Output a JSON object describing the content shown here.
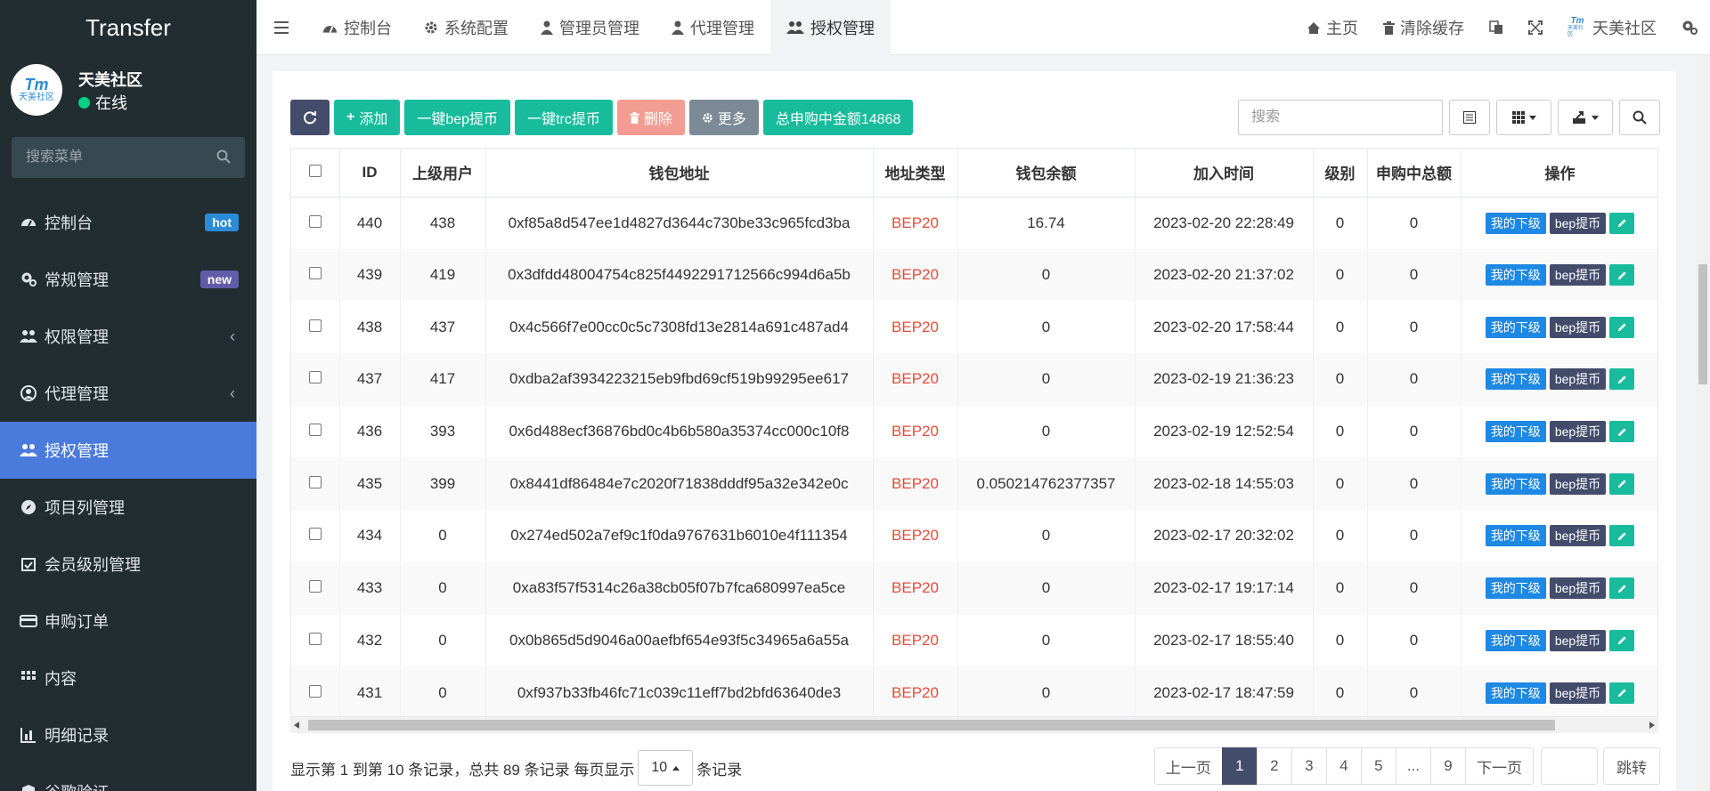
{
  "app": {
    "title": "Transfer",
    "user_name": "天美社区",
    "user_status": "在线",
    "logo_text": "Tm",
    "logo_sub": "天美社区"
  },
  "sidebar": {
    "search_placeholder": "搜索菜单",
    "items": [
      {
        "label": "控制台",
        "icon": "dashboard-icon",
        "badge": "hot"
      },
      {
        "label": "常规管理",
        "icon": "cogs-icon",
        "badge": "new"
      },
      {
        "label": "权限管理",
        "icon": "users-icon",
        "chevron": "‹"
      },
      {
        "label": "代理管理",
        "icon": "user-circle-icon",
        "chevron": "‹"
      },
      {
        "label": "授权管理",
        "icon": "users-icon",
        "active": true
      },
      {
        "label": "项目列管理",
        "icon": "compass-icon"
      },
      {
        "label": "会员级别管理",
        "icon": "calendar-check-icon"
      },
      {
        "label": "申购订单",
        "icon": "credit-card-icon"
      },
      {
        "label": "内容",
        "icon": "grid-icon"
      },
      {
        "label": "明细记录",
        "icon": "bar-chart-icon"
      },
      {
        "label": "谷歌验证",
        "icon": "shield-icon"
      }
    ]
  },
  "topnav": {
    "tabs": [
      {
        "label": "控制台",
        "icon": "dashboard-icon"
      },
      {
        "label": "系统配置",
        "icon": "gear-icon"
      },
      {
        "label": "管理员管理",
        "icon": "user-icon"
      },
      {
        "label": "代理管理",
        "icon": "user-icon"
      },
      {
        "label": "授权管理",
        "icon": "users-icon",
        "active": true
      }
    ],
    "right": {
      "home": "主页",
      "clear_cache": "清除缓存",
      "user": "天美社区"
    }
  },
  "toolbar": {
    "add": "添加",
    "bep_withdraw": "一键bep提币",
    "trc_withdraw": "一键trc提币",
    "delete": "删除",
    "more": "更多",
    "total": "总申购中金额14868",
    "search_placeholder": "搜索"
  },
  "table": {
    "headers": [
      "ID",
      "上级用户",
      "钱包地址",
      "地址类型",
      "钱包余额",
      "加入时间",
      "级别",
      "申购中总额",
      "操作"
    ],
    "op_labels": {
      "subordinates": "我的下级",
      "bep": "bep提币"
    },
    "rows": [
      {
        "id": "440",
        "parent": "438",
        "address": "0xf85a8d547ee1d4827d3644c730be33c965fcd3ba",
        "type": "BEP20",
        "balance": "16.74",
        "joined": "2023-02-20 22:28:49",
        "level": "0",
        "total": "0"
      },
      {
        "id": "439",
        "parent": "419",
        "address": "0x3dfdd48004754c825f4492291712566c994d6a5b",
        "type": "BEP20",
        "balance": "0",
        "joined": "2023-02-20 21:37:02",
        "level": "0",
        "total": "0"
      },
      {
        "id": "438",
        "parent": "437",
        "address": "0x4c566f7e00cc0c5c7308fd13e2814a691c487ad4",
        "type": "BEP20",
        "balance": "0",
        "joined": "2023-02-20 17:58:44",
        "level": "0",
        "total": "0"
      },
      {
        "id": "437",
        "parent": "417",
        "address": "0xdba2af3934223215eb9fbd69cf519b99295ee617",
        "type": "BEP20",
        "balance": "0",
        "joined": "2023-02-19 21:36:23",
        "level": "0",
        "total": "0"
      },
      {
        "id": "436",
        "parent": "393",
        "address": "0x6d488ecf36876bd0c4b6b580a35374cc000c10f8",
        "type": "BEP20",
        "balance": "0",
        "joined": "2023-02-19 12:52:54",
        "level": "0",
        "total": "0"
      },
      {
        "id": "435",
        "parent": "399",
        "address": "0x8441df86484e7c2020f71838dddf95a32e342e0c",
        "type": "BEP20",
        "balance": "0.050214762377357",
        "joined": "2023-02-18 14:55:03",
        "level": "0",
        "total": "0"
      },
      {
        "id": "434",
        "parent": "0",
        "address": "0x274ed502a7ef9c1f0da9767631b6010e4f111354",
        "type": "BEP20",
        "balance": "0",
        "joined": "2023-02-17 20:32:02",
        "level": "0",
        "total": "0"
      },
      {
        "id": "433",
        "parent": "0",
        "address": "0xa83f57f5314c26a38cb05f07b7fca680997ea5ce",
        "type": "BEP20",
        "balance": "0",
        "joined": "2023-02-17 19:17:14",
        "level": "0",
        "total": "0"
      },
      {
        "id": "432",
        "parent": "0",
        "address": "0x0b865d5d9046a00aefbf654e93f5c34965a6a55a",
        "type": "BEP20",
        "balance": "0",
        "joined": "2023-02-17 18:55:40",
        "level": "0",
        "total": "0"
      },
      {
        "id": "431",
        "parent": "0",
        "address": "0xf937b33fb46fc71c039c11eff7bd2bfd63640de3",
        "type": "BEP20",
        "balance": "0",
        "joined": "2023-02-17 18:47:59",
        "level": "0",
        "total": "0"
      }
    ]
  },
  "footer": {
    "info_prefix": "显示第 1 到第 10 条记录，总共 89 条记录 每页显示",
    "page_size": "10",
    "info_suffix": "条记录",
    "prev": "上一页",
    "next": "下一页",
    "pages": [
      "1",
      "2",
      "3",
      "4",
      "5",
      "...",
      "9"
    ],
    "active_page": "1",
    "jump": "跳转"
  },
  "colors": {
    "sidebar_bg": "#222d32",
    "active_menu": "#4a7bdc",
    "primary_green": "#18bc9c",
    "dark_btn": "#444c6c",
    "danger_light": "#f39c92",
    "blue_btn": "#1e88e5",
    "bep_red": "#e74c3c"
  }
}
